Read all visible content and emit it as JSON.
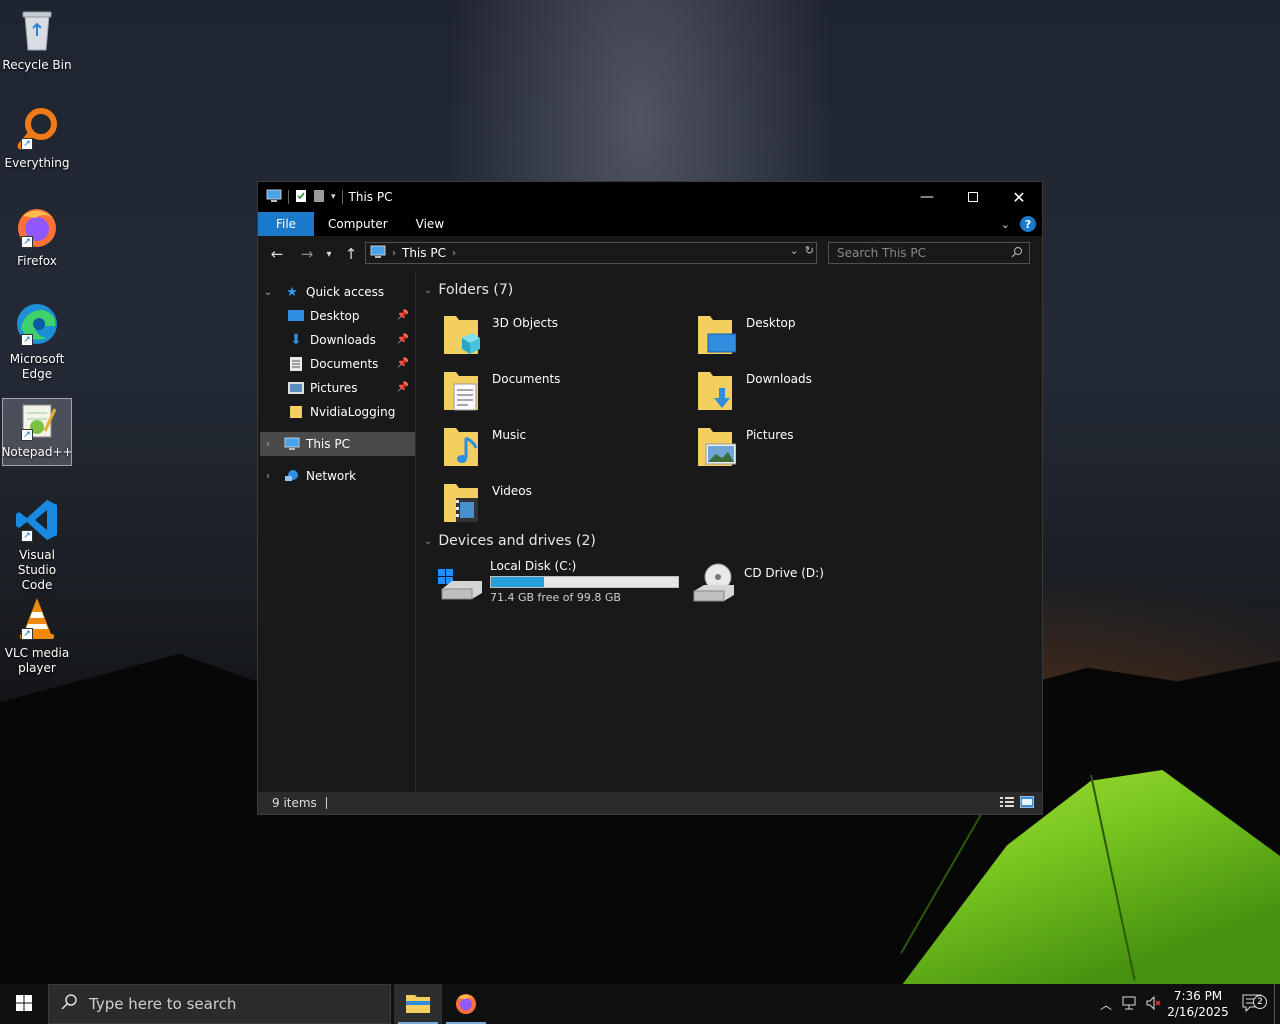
{
  "desktop": {
    "icons": [
      {
        "label": "Recycle Bin"
      },
      {
        "label": "Everything"
      },
      {
        "label": "Firefox"
      },
      {
        "label": "Microsoft Edge"
      },
      {
        "label": "Notepad++"
      },
      {
        "label": "Visual Studio Code"
      },
      {
        "label": "VLC media player"
      }
    ]
  },
  "window": {
    "title": "This PC",
    "ribbon_tabs": [
      "File",
      "Computer",
      "View"
    ],
    "help_label": "?",
    "address": {
      "crumb": "This PC"
    },
    "search": {
      "placeholder": "Search This PC"
    },
    "sidebar": {
      "quick_access": "Quick access",
      "items": [
        {
          "label": "Desktop",
          "pinned": true
        },
        {
          "label": "Downloads",
          "pinned": true
        },
        {
          "label": "Documents",
          "pinned": true
        },
        {
          "label": "Pictures",
          "pinned": true
        },
        {
          "label": "NvidiaLogging",
          "pinned": false
        }
      ],
      "this_pc": "This PC",
      "network": "Network"
    },
    "content": {
      "folders_header": "Folders (7)",
      "folders": [
        "3D Objects",
        "Desktop",
        "Documents",
        "Downloads",
        "Music",
        "Pictures",
        "Videos"
      ],
      "devices_header": "Devices and drives (2)",
      "drives": [
        {
          "name": "Local Disk (C:)",
          "free_text": "71.4 GB free of 99.8 GB",
          "used_fraction": 0.285
        },
        {
          "name": "CD Drive (D:)"
        }
      ]
    },
    "status": {
      "items": "9 items"
    }
  },
  "taskbar": {
    "search_placeholder": "Type here to search",
    "time": "7:36 PM",
    "date": "2/16/2025",
    "notification_count": "2"
  }
}
